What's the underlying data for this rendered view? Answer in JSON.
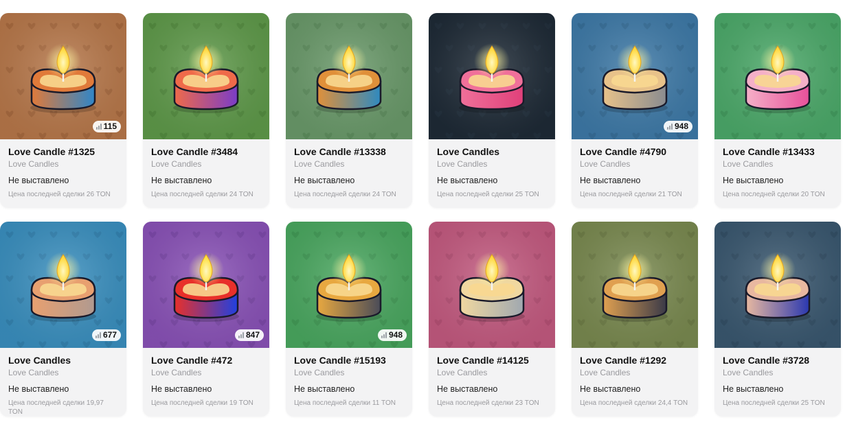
{
  "gifts": [
    {
      "title": "Love Candle #1325",
      "collection": "Love Candles",
      "status": "Не выставлено",
      "last_price": "Цена последней сделки 26 TON",
      "badge": "115",
      "bg": "#b8784a",
      "pattern": "#9e6138",
      "wax_top": "#e07a3a",
      "wax_bottom": "#2f86c8",
      "flame": "#ffd83a"
    },
    {
      "title": "Love Candle #3484",
      "collection": "Love Candles",
      "status": "Не выставлено",
      "last_price": "Цена последней сделки 24 TON",
      "badge": "",
      "bg": "#5f9a4a",
      "pattern": "#4d853a",
      "wax_top": "#ef6a4a",
      "wax_bottom": "#7a3cc8",
      "flame": "#ffd83a"
    },
    {
      "title": "Love Candle #13338",
      "collection": "Love Candles",
      "status": "Не выставлено",
      "last_price": "Цена последней сделки 24 TON",
      "badge": "",
      "bg": "#6a9a6a",
      "pattern": "#578757",
      "wax_top": "#e0903a",
      "wax_bottom": "#2e8ac0",
      "flame": "#ffd83a"
    },
    {
      "title": "Love Candles",
      "collection": "Love Candles",
      "status": "Не выставлено",
      "last_price": "Цена последней сделки 25 TON",
      "badge": "",
      "bg": "#1e2a36",
      "pattern": "#263442",
      "wax_top": "#f0709a",
      "wax_bottom": "#e0407a",
      "flame": "#ffd83a"
    },
    {
      "title": "Love Candle #4790",
      "collection": "Love Candles",
      "status": "Не выставлено",
      "last_price": "Цена последней сделки 21 TON",
      "badge": "948",
      "bg": "#3e7aa8",
      "pattern": "#336891",
      "wax_top": "#e8c28a",
      "wax_bottom": "#8a8c90",
      "flame": "#ffd83a"
    },
    {
      "title": "Love Candle #13433",
      "collection": "Love Candles",
      "status": "Не выставлено",
      "last_price": "Цена последней сделки 20 TON",
      "badge": "",
      "bg": "#4caa6a",
      "pattern": "#3e9459",
      "wax_top": "#f5b0c8",
      "wax_bottom": "#e8509a",
      "flame": "#ffd83a"
    },
    {
      "title": "Love Candles",
      "collection": "Love Candles",
      "status": "Не выставлено",
      "last_price": "Цена последней сделки 19,97 TON",
      "badge": "677",
      "bg": "#3a90c0",
      "pattern": "#2f7ca8",
      "wax_top": "#e8a070",
      "wax_bottom": "#b09a90",
      "flame": "#ffd83a"
    },
    {
      "title": "Love Candle #472",
      "collection": "Love Candles",
      "status": "Не выставлено",
      "last_price": "Цена последней сделки 19 TON",
      "badge": "847",
      "bg": "#8a52b8",
      "pattern": "#7644a2",
      "wax_top": "#e8302a",
      "wax_bottom": "#2040e0",
      "flame": "#ffe040"
    },
    {
      "title": "Love Candle #15193",
      "collection": "Love Candles",
      "status": "Не выставлено",
      "last_price": "Цена последней сделки 11 TON",
      "badge": "948",
      "bg": "#4aa860",
      "pattern": "#3d9351",
      "wax_top": "#e8a840",
      "wax_bottom": "#4a4c58",
      "flame": "#ffd83a"
    },
    {
      "title": "Love Candle #14125",
      "collection": "Love Candles",
      "status": "Не выставлено",
      "last_price": "Цена последней сделки 23 TON",
      "badge": "",
      "bg": "#c45a80",
      "pattern": "#ad4a6e",
      "wax_top": "#f0d8a0",
      "wax_bottom": "#a0a8b0",
      "flame": "#ffd83a"
    },
    {
      "title": "Love Candle #1292",
      "collection": "Love Candles",
      "status": "Не выставлено",
      "last_price": "Цена последней сделки 24,4 TON",
      "badge": "",
      "bg": "#7a8a50",
      "pattern": "#687742",
      "wax_top": "#e0a050",
      "wax_bottom": "#3a3a48",
      "flame": "#ffd83a"
    },
    {
      "title": "Love Candle #3728",
      "collection": "Love Candles",
      "status": "Не выставлено",
      "last_price": "Цена последней сделки 25 TON",
      "badge": "",
      "bg": "#3a5870",
      "pattern": "#304a60",
      "wax_top": "#e8b8a0",
      "wax_bottom": "#2a38b0",
      "flame": "#ffd83a"
    }
  ]
}
